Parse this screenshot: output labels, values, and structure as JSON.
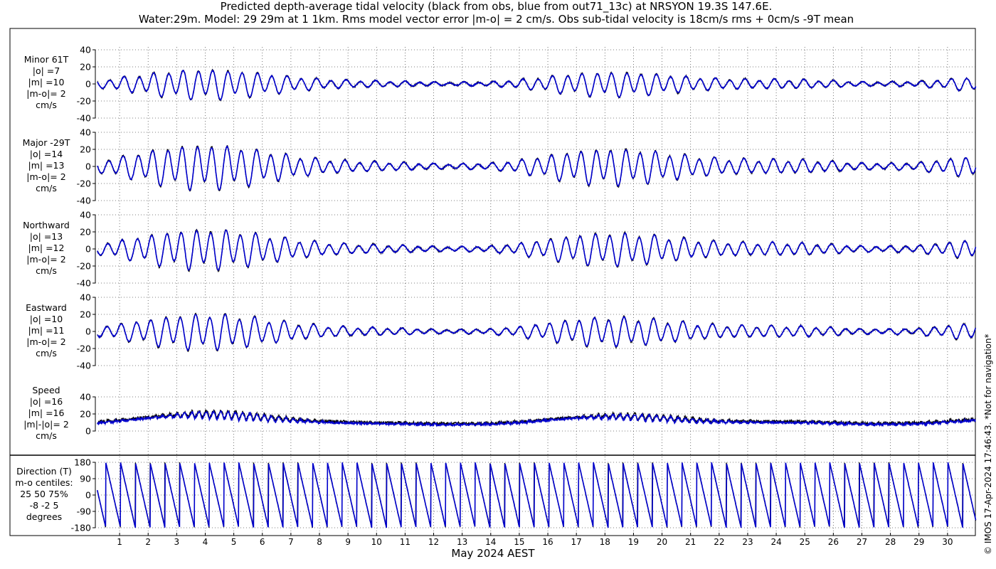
{
  "title_line1": "Predicted depth-average tidal velocity (black from obs, blue from out71_13c) at NRSYON 19.3S 147.6E.",
  "title_line2": "Water:29m. Model: 29 29m at 1 1km. Rms model vector error |m-o| = 2 cm/s. Obs sub-tidal velocity is 18cm/s rms + 0cm/s -9T mean",
  "copyright": "© IMOS 17-Apr-2024 17:46:43. *Not for navigation*",
  "chart_data": {
    "type": "line",
    "xlabel": "May 2024 AEST",
    "x_ticks": [
      "1",
      "2",
      "3",
      "4",
      "5",
      "6",
      "7",
      "8",
      "9",
      "10",
      "11",
      "12",
      "13",
      "14",
      "15",
      "16",
      "17",
      "18",
      "19",
      "20",
      "21",
      "22",
      "23",
      "24",
      "25",
      "26",
      "27",
      "28",
      "29",
      "30"
    ],
    "x_range_days": [
      0.2,
      31.0
    ],
    "series_legend": [
      {
        "name": "obs",
        "color": "#000000"
      },
      {
        "name": "out71_13c",
        "color": "#0000cc"
      }
    ],
    "panels": [
      {
        "key": "minor",
        "label_lines": [
          "Minor 61T",
          "|o| =7",
          "|m| =10",
          "|m-o|= 2",
          "cm/s"
        ],
        "ylim": [
          -40,
          40
        ],
        "yticks": [
          "40",
          "20",
          "0",
          "-20",
          "-40"
        ],
        "amplitude_cm_s": 20,
        "kind": "tidal"
      },
      {
        "key": "major",
        "label_lines": [
          "Major -29T",
          "|o| =14",
          "|m| =13",
          "|m-o|= 2",
          "cm/s"
        ],
        "ylim": [
          -40,
          40
        ],
        "yticks": [
          "40",
          "20",
          "0",
          "-20",
          "-40"
        ],
        "amplitude_cm_s": 30,
        "kind": "tidal"
      },
      {
        "key": "north",
        "label_lines": [
          "Northward",
          "|o| =13",
          "|m| =12",
          "|m-o|= 2",
          "cm/s"
        ],
        "ylim": [
          -40,
          40
        ],
        "yticks": [
          "40",
          "20",
          "0",
          "-20",
          "-40"
        ],
        "amplitude_cm_s": 27,
        "kind": "tidal"
      },
      {
        "key": "east",
        "label_lines": [
          "Eastward",
          "|o| =10",
          "|m| =11",
          "|m-o|= 2",
          "cm/s"
        ],
        "ylim": [
          -40,
          40
        ],
        "yticks": [
          "40",
          "20",
          "0",
          "-20",
          "-40"
        ],
        "amplitude_cm_s": 24,
        "kind": "tidal"
      },
      {
        "key": "speed",
        "label_lines": [
          "Speed",
          "|o| =16",
          "|m| =16",
          "|m|-|o|= 2",
          "cm/s"
        ],
        "ylim": [
          0,
          40
        ],
        "yticks": [
          "40",
          "20",
          "0"
        ],
        "amplitude_cm_s": 30,
        "kind": "speed"
      },
      {
        "key": "direction",
        "label_lines": [
          "Direction (T)",
          "m-o centiles:",
          "25  50  75%",
          "-8 -2  5",
          "degrees"
        ],
        "ylim": [
          -180,
          180
        ],
        "yticks": [
          "180",
          "90",
          "0",
          "-90",
          "-180"
        ],
        "kind": "direction"
      }
    ]
  }
}
